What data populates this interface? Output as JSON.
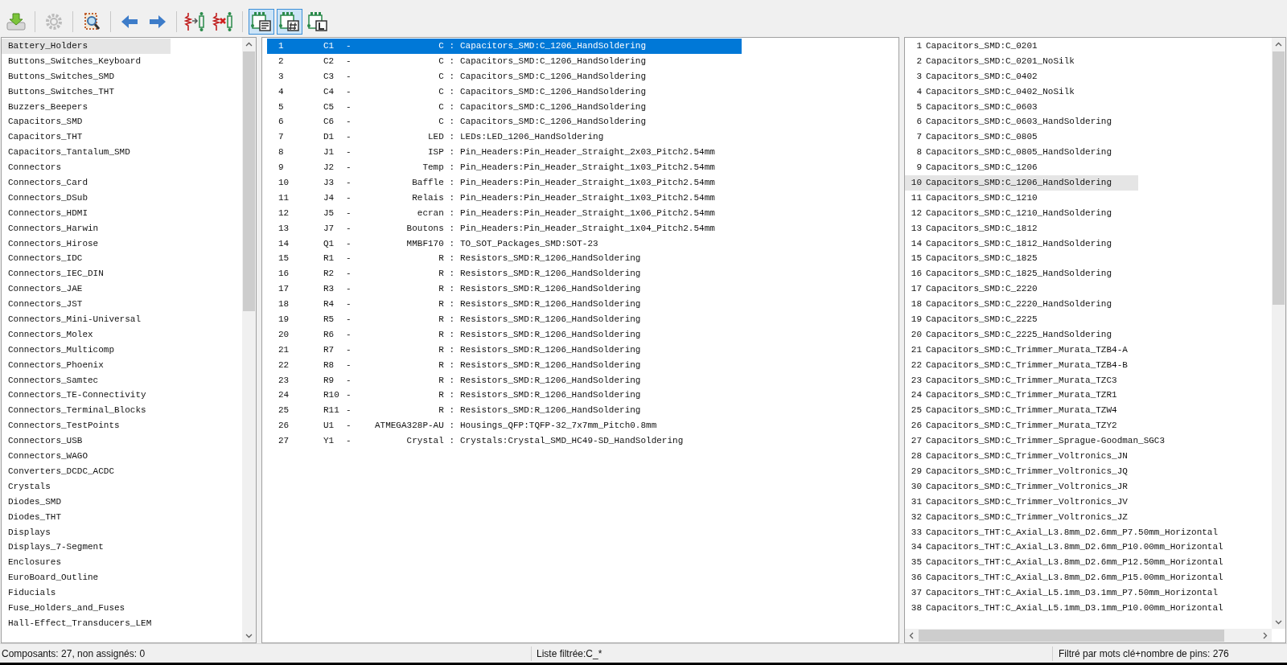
{
  "toolbar": [
    {
      "kind": "download",
      "toggled": false
    },
    {
      "kind": "sep"
    },
    {
      "kind": "gear",
      "toggled": false
    },
    {
      "kind": "sep"
    },
    {
      "kind": "inspect",
      "toggled": false
    },
    {
      "kind": "sep"
    },
    {
      "kind": "left",
      "toggled": false
    },
    {
      "kind": "right",
      "toggled": false
    },
    {
      "kind": "sep"
    },
    {
      "kind": "assign",
      "toggled": false
    },
    {
      "kind": "unassign",
      "toggled": false
    },
    {
      "kind": "sep"
    },
    {
      "kind": "filter-keywords",
      "toggled": true
    },
    {
      "kind": "filter-pins",
      "toggled": true
    },
    {
      "kind": "filter-library",
      "toggled": false
    }
  ],
  "libraries": [
    {
      "name": "Battery_Holders",
      "selected": true
    },
    {
      "name": "Buttons_Switches_Keyboard",
      "selected": false
    },
    {
      "name": "Buttons_Switches_SMD",
      "selected": false
    },
    {
      "name": "Buttons_Switches_THT",
      "selected": false
    },
    {
      "name": "Buzzers_Beepers",
      "selected": false
    },
    {
      "name": "Capacitors_SMD",
      "selected": false
    },
    {
      "name": "Capacitors_THT",
      "selected": false
    },
    {
      "name": "Capacitors_Tantalum_SMD",
      "selected": false
    },
    {
      "name": "Connectors",
      "selected": false
    },
    {
      "name": "Connectors_Card",
      "selected": false
    },
    {
      "name": "Connectors_DSub",
      "selected": false
    },
    {
      "name": "Connectors_HDMI",
      "selected": false
    },
    {
      "name": "Connectors_Harwin",
      "selected": false
    },
    {
      "name": "Connectors_Hirose",
      "selected": false
    },
    {
      "name": "Connectors_IDC",
      "selected": false
    },
    {
      "name": "Connectors_IEC_DIN",
      "selected": false
    },
    {
      "name": "Connectors_JAE",
      "selected": false
    },
    {
      "name": "Connectors_JST",
      "selected": false
    },
    {
      "name": "Connectors_Mini-Universal",
      "selected": false
    },
    {
      "name": "Connectors_Molex",
      "selected": false
    },
    {
      "name": "Connectors_Multicomp",
      "selected": false
    },
    {
      "name": "Connectors_Phoenix",
      "selected": false
    },
    {
      "name": "Connectors_Samtec",
      "selected": false
    },
    {
      "name": "Connectors_TE-Connectivity",
      "selected": false
    },
    {
      "name": "Connectors_Terminal_Blocks",
      "selected": false
    },
    {
      "name": "Connectors_TestPoints",
      "selected": false
    },
    {
      "name": "Connectors_USB",
      "selected": false
    },
    {
      "name": "Connectors_WAGO",
      "selected": false
    },
    {
      "name": "Converters_DCDC_ACDC",
      "selected": false
    },
    {
      "name": "Crystals",
      "selected": false
    },
    {
      "name": "Diodes_SMD",
      "selected": false
    },
    {
      "name": "Diodes_THT",
      "selected": false
    },
    {
      "name": "Displays",
      "selected": false
    },
    {
      "name": "Displays_7-Segment",
      "selected": false
    },
    {
      "name": "Enclosures",
      "selected": false
    },
    {
      "name": "EuroBoard_Outline",
      "selected": false
    },
    {
      "name": "Fiducials",
      "selected": false
    },
    {
      "name": "Fuse_Holders_and_Fuses",
      "selected": false
    },
    {
      "name": "Hall-Effect_Transducers_LEM",
      "selected": false
    }
  ],
  "components": [
    {
      "num": "1",
      "ref": "C1",
      "dash": "-",
      "value": "C :",
      "footprint": "Capacitors_SMD:C_1206_HandSoldering",
      "selected": true
    },
    {
      "num": "2",
      "ref": "C2",
      "dash": "-",
      "value": "C :",
      "footprint": "Capacitors_SMD:C_1206_HandSoldering",
      "selected": false
    },
    {
      "num": "3",
      "ref": "C3",
      "dash": "-",
      "value": "C :",
      "footprint": "Capacitors_SMD:C_1206_HandSoldering",
      "selected": false
    },
    {
      "num": "4",
      "ref": "C4",
      "dash": "-",
      "value": "C :",
      "footprint": "Capacitors_SMD:C_1206_HandSoldering",
      "selected": false
    },
    {
      "num": "5",
      "ref": "C5",
      "dash": "-",
      "value": "C :",
      "footprint": "Capacitors_SMD:C_1206_HandSoldering",
      "selected": false
    },
    {
      "num": "6",
      "ref": "C6",
      "dash": "-",
      "value": "C :",
      "footprint": "Capacitors_SMD:C_1206_HandSoldering",
      "selected": false
    },
    {
      "num": "7",
      "ref": "D1",
      "dash": "-",
      "value": "LED :",
      "footprint": "LEDs:LED_1206_HandSoldering",
      "selected": false
    },
    {
      "num": "8",
      "ref": "J1",
      "dash": "-",
      "value": "ISP :",
      "footprint": "Pin_Headers:Pin_Header_Straight_2x03_Pitch2.54mm",
      "selected": false
    },
    {
      "num": "9",
      "ref": "J2",
      "dash": "-",
      "value": "Temp :",
      "footprint": "Pin_Headers:Pin_Header_Straight_1x03_Pitch2.54mm",
      "selected": false
    },
    {
      "num": "10",
      "ref": "J3",
      "dash": "-",
      "value": "Baffle :",
      "footprint": "Pin_Headers:Pin_Header_Straight_1x03_Pitch2.54mm",
      "selected": false
    },
    {
      "num": "11",
      "ref": "J4",
      "dash": "-",
      "value": "Relais :",
      "footprint": "Pin_Headers:Pin_Header_Straight_1x03_Pitch2.54mm",
      "selected": false
    },
    {
      "num": "12",
      "ref": "J5",
      "dash": "-",
      "value": "ecran :",
      "footprint": "Pin_Headers:Pin_Header_Straight_1x06_Pitch2.54mm",
      "selected": false
    },
    {
      "num": "13",
      "ref": "J7",
      "dash": "-",
      "value": "Boutons :",
      "footprint": "Pin_Headers:Pin_Header_Straight_1x04_Pitch2.54mm",
      "selected": false
    },
    {
      "num": "14",
      "ref": "Q1",
      "dash": "-",
      "value": "MMBF170 :",
      "footprint": "TO_SOT_Packages_SMD:SOT-23",
      "selected": false
    },
    {
      "num": "15",
      "ref": "R1",
      "dash": "-",
      "value": "R :",
      "footprint": "Resistors_SMD:R_1206_HandSoldering",
      "selected": false
    },
    {
      "num": "16",
      "ref": "R2",
      "dash": "-",
      "value": "R :",
      "footprint": "Resistors_SMD:R_1206_HandSoldering",
      "selected": false
    },
    {
      "num": "17",
      "ref": "R3",
      "dash": "-",
      "value": "R :",
      "footprint": "Resistors_SMD:R_1206_HandSoldering",
      "selected": false
    },
    {
      "num": "18",
      "ref": "R4",
      "dash": "-",
      "value": "R :",
      "footprint": "Resistors_SMD:R_1206_HandSoldering",
      "selected": false
    },
    {
      "num": "19",
      "ref": "R5",
      "dash": "-",
      "value": "R :",
      "footprint": "Resistors_SMD:R_1206_HandSoldering",
      "selected": false
    },
    {
      "num": "20",
      "ref": "R6",
      "dash": "-",
      "value": "R :",
      "footprint": "Resistors_SMD:R_1206_HandSoldering",
      "selected": false
    },
    {
      "num": "21",
      "ref": "R7",
      "dash": "-",
      "value": "R :",
      "footprint": "Resistors_SMD:R_1206_HandSoldering",
      "selected": false
    },
    {
      "num": "22",
      "ref": "R8",
      "dash": "-",
      "value": "R :",
      "footprint": "Resistors_SMD:R_1206_HandSoldering",
      "selected": false
    },
    {
      "num": "23",
      "ref": "R9",
      "dash": "-",
      "value": "R :",
      "footprint": "Resistors_SMD:R_1206_HandSoldering",
      "selected": false
    },
    {
      "num": "24",
      "ref": "R10",
      "dash": "-",
      "value": "R :",
      "footprint": "Resistors_SMD:R_1206_HandSoldering",
      "selected": false
    },
    {
      "num": "25",
      "ref": "R11",
      "dash": "-",
      "value": "R :",
      "footprint": "Resistors_SMD:R_1206_HandSoldering",
      "selected": false
    },
    {
      "num": "26",
      "ref": "U1",
      "dash": "-",
      "value": "ATMEGA328P-AU :",
      "footprint": "Housings_QFP:TQFP-32_7x7mm_Pitch0.8mm",
      "selected": false
    },
    {
      "num": "27",
      "ref": "Y1",
      "dash": "-",
      "value": "Crystal :",
      "footprint": "Crystals:Crystal_SMD_HC49-SD_HandSoldering",
      "selected": false
    }
  ],
  "footprints": [
    {
      "num": "1",
      "name": "Capacitors_SMD:C_0201",
      "selected": false
    },
    {
      "num": "2",
      "name": "Capacitors_SMD:C_0201_NoSilk",
      "selected": false
    },
    {
      "num": "3",
      "name": "Capacitors_SMD:C_0402",
      "selected": false
    },
    {
      "num": "4",
      "name": "Capacitors_SMD:C_0402_NoSilk",
      "selected": false
    },
    {
      "num": "5",
      "name": "Capacitors_SMD:C_0603",
      "selected": false
    },
    {
      "num": "6",
      "name": "Capacitors_SMD:C_0603_HandSoldering",
      "selected": false
    },
    {
      "num": "7",
      "name": "Capacitors_SMD:C_0805",
      "selected": false
    },
    {
      "num": "8",
      "name": "Capacitors_SMD:C_0805_HandSoldering",
      "selected": false
    },
    {
      "num": "9",
      "name": "Capacitors_SMD:C_1206",
      "selected": false
    },
    {
      "num": "10",
      "name": "Capacitors_SMD:C_1206_HandSoldering",
      "selected": true
    },
    {
      "num": "11",
      "name": "Capacitors_SMD:C_1210",
      "selected": false
    },
    {
      "num": "12",
      "name": "Capacitors_SMD:C_1210_HandSoldering",
      "selected": false
    },
    {
      "num": "13",
      "name": "Capacitors_SMD:C_1812",
      "selected": false
    },
    {
      "num": "14",
      "name": "Capacitors_SMD:C_1812_HandSoldering",
      "selected": false
    },
    {
      "num": "15",
      "name": "Capacitors_SMD:C_1825",
      "selected": false
    },
    {
      "num": "16",
      "name": "Capacitors_SMD:C_1825_HandSoldering",
      "selected": false
    },
    {
      "num": "17",
      "name": "Capacitors_SMD:C_2220",
      "selected": false
    },
    {
      "num": "18",
      "name": "Capacitors_SMD:C_2220_HandSoldering",
      "selected": false
    },
    {
      "num": "19",
      "name": "Capacitors_SMD:C_2225",
      "selected": false
    },
    {
      "num": "20",
      "name": "Capacitors_SMD:C_2225_HandSoldering",
      "selected": false
    },
    {
      "num": "21",
      "name": "Capacitors_SMD:C_Trimmer_Murata_TZB4-A",
      "selected": false
    },
    {
      "num": "22",
      "name": "Capacitors_SMD:C_Trimmer_Murata_TZB4-B",
      "selected": false
    },
    {
      "num": "23",
      "name": "Capacitors_SMD:C_Trimmer_Murata_TZC3",
      "selected": false
    },
    {
      "num": "24",
      "name": "Capacitors_SMD:C_Trimmer_Murata_TZR1",
      "selected": false
    },
    {
      "num": "25",
      "name": "Capacitors_SMD:C_Trimmer_Murata_TZW4",
      "selected": false
    },
    {
      "num": "26",
      "name": "Capacitors_SMD:C_Trimmer_Murata_TZY2",
      "selected": false
    },
    {
      "num": "27",
      "name": "Capacitors_SMD:C_Trimmer_Sprague-Goodman_SGC3",
      "selected": false
    },
    {
      "num": "28",
      "name": "Capacitors_SMD:C_Trimmer_Voltronics_JN",
      "selected": false
    },
    {
      "num": "29",
      "name": "Capacitors_SMD:C_Trimmer_Voltronics_JQ",
      "selected": false
    },
    {
      "num": "30",
      "name": "Capacitors_SMD:C_Trimmer_Voltronics_JR",
      "selected": false
    },
    {
      "num": "31",
      "name": "Capacitors_SMD:C_Trimmer_Voltronics_JV",
      "selected": false
    },
    {
      "num": "32",
      "name": "Capacitors_SMD:C_Trimmer_Voltronics_JZ",
      "selected": false
    },
    {
      "num": "33",
      "name": "Capacitors_THT:C_Axial_L3.8mm_D2.6mm_P7.50mm_Horizontal",
      "selected": false
    },
    {
      "num": "34",
      "name": "Capacitors_THT:C_Axial_L3.8mm_D2.6mm_P10.00mm_Horizontal",
      "selected": false
    },
    {
      "num": "35",
      "name": "Capacitors_THT:C_Axial_L3.8mm_D2.6mm_P12.50mm_Horizontal",
      "selected": false
    },
    {
      "num": "36",
      "name": "Capacitors_THT:C_Axial_L3.8mm_D2.6mm_P15.00mm_Horizontal",
      "selected": false
    },
    {
      "num": "37",
      "name": "Capacitors_THT:C_Axial_L5.1mm_D3.1mm_P7.50mm_Horizontal",
      "selected": false
    },
    {
      "num": "38",
      "name": "Capacitors_THT:C_Axial_L5.1mm_D3.1mm_P10.00mm_Horizontal",
      "selected": false
    }
  ],
  "status_bar": [
    "Composants: 27, non assignés: 0",
    "Liste filtrée:C_*",
    "Filtré par mots clé+nombre de pins: 276"
  ]
}
